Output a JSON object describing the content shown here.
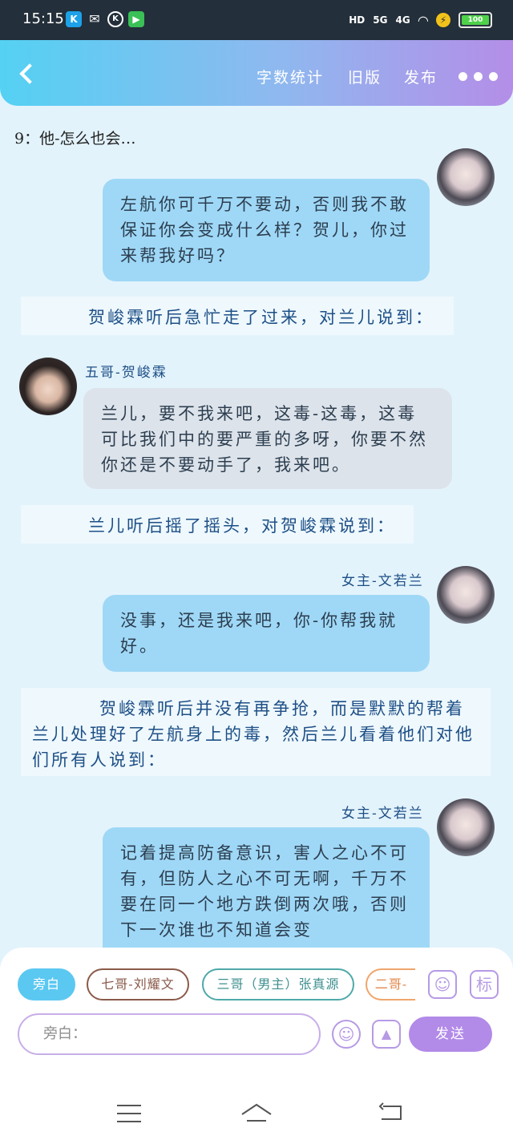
{
  "status_bar": {
    "time": "15:15",
    "app_icons": [
      "k-app-icon",
      "wechat-icon",
      "k-circle-icon",
      "video-app-icon"
    ],
    "network": "HD",
    "sim1": "5G",
    "sim2": "4G",
    "battery": "100"
  },
  "header": {
    "back": "back-icon",
    "word_count": "字数统计",
    "old_version": "旧版",
    "publish": "发布",
    "more": "more-icon"
  },
  "chapter_title": "9：他-怎么也会…",
  "messages": [
    {
      "type": "me",
      "text": "左航你可千万不要动，否则我不敢保证你会变成什么样？贺儿，你过来帮我好吗？"
    },
    {
      "type": "narration",
      "text": "贺峻霖听后急忙走了过来，对兰儿说到："
    },
    {
      "type": "other",
      "speaker": "五哥-贺峻霖",
      "text": "兰儿，要不我来吧，这毒-这毒，这毒可比我们中的要严重的多呀，你要不然你还是不要动手了，我来吧。"
    },
    {
      "type": "narration",
      "text": "兰儿听后摇了摇头，对贺峻霖说到："
    },
    {
      "type": "me",
      "speaker": "女主-文若兰",
      "text": "没事，还是我来吧，你-你帮我就好。"
    },
    {
      "type": "narration",
      "text": "贺峻霖听后并没有再争抢，而是默默的帮着兰儿处理好了左航身上的毒，然后兰儿看着他们对他们所有人说到："
    },
    {
      "type": "me",
      "speaker": "女主-文若兰",
      "text": "记着提高防备意识，害人之心不可有，但防人之心不可无啊，千万不要在同一个地方跌倒两次哦，否则下一次谁也不知道会变"
    }
  ],
  "compose": {
    "chips": [
      "旁白",
      "七哥-刘耀文",
      "三哥（男主）张真源",
      "二哥-"
    ],
    "placeholder": "旁白：",
    "send": "发送",
    "tag_label": "标"
  }
}
